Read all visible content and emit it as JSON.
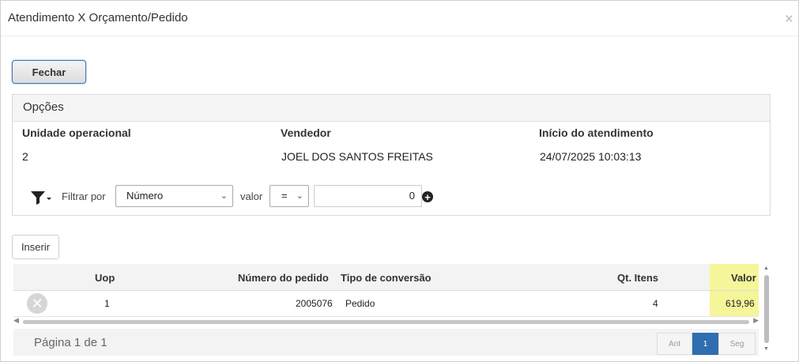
{
  "dialog": {
    "title": "Atendimento X Orçamento/Pedido",
    "close": "×"
  },
  "buttons": {
    "fechar": "Fechar",
    "inserir": "Inserir"
  },
  "opcoes": {
    "heading": "Opções",
    "fields": [
      {
        "label": "Unidade operacional",
        "value": "2"
      },
      {
        "label": "Vendedor",
        "value": "JOEL DOS SANTOS FREITAS"
      },
      {
        "label": "Início do atendimento",
        "value": "24/07/2025 10:03:13"
      }
    ],
    "filter": {
      "filter_by_label": "Filtrar por",
      "field_selected": "Número",
      "valor_label": "valor",
      "operator_selected": "=",
      "value": "0"
    }
  },
  "table": {
    "columns": [
      "Uop",
      "Número do pedido",
      "Tipo de conversão",
      "Qt. Itens",
      "Valor"
    ],
    "rows": [
      {
        "uop": "1",
        "numero": "2005076",
        "tipo": "Pedido",
        "qt_itens": "4",
        "valor": "619,96"
      }
    ],
    "highlight_color": "#f5f59a"
  },
  "pager": {
    "info": "Página 1 de 1",
    "prev": "Ant",
    "current": "1",
    "next": "Seg"
  },
  "colors": {
    "accent": "#2f6eb0",
    "button_border": "#3d74c4"
  }
}
